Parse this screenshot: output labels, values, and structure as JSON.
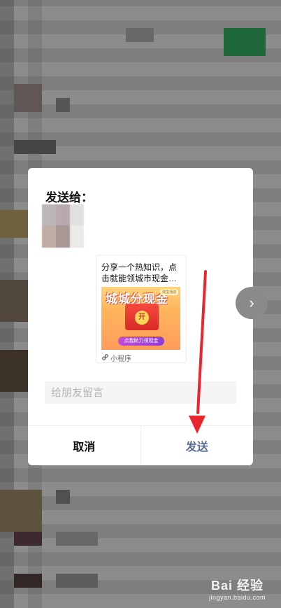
{
  "dialog": {
    "title": "发送给：",
    "card": {
      "title": "分享一个热知识，点击就能领城市现金…",
      "thumb_headline": "城城分现金",
      "thumb_badge": "淘宝活动",
      "thumb_coin": "开",
      "thumb_button": "点我助力领现金",
      "footer_label": "小程序"
    },
    "message_placeholder": "给朋友留言",
    "cancel_label": "取消",
    "send_label": "发送"
  },
  "next_button": "›",
  "annotation_color": "#e8262d",
  "watermark": {
    "main": "Bai 经验",
    "sub": "jingyan.baidu.com"
  }
}
